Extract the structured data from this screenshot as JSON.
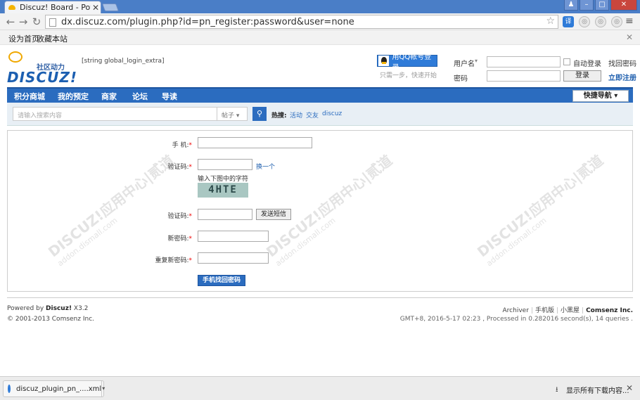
{
  "browser": {
    "tab_title": "Discuz! Board - Powered",
    "url": "dx.discuz.com/plugin.php?id=pn_register:password&user=none",
    "ext_translate": "译"
  },
  "bookmarks": [
    "设为首页",
    "收藏本站"
  ],
  "header": {
    "logo_sub": "社区动力",
    "logo_main": "DISCUZ!",
    "extra_text": "[string global_login_extra]",
    "qq_login": "用QQ帐号登录",
    "qq_hint": "只需一步，快速开始",
    "username_label": "用户名",
    "password_label": "密码",
    "auto_login": "自动登录",
    "find_password": "找回密码",
    "login_button": "登录",
    "register_link": "立即注册"
  },
  "nav": {
    "items": [
      "积分商城",
      "我的预定",
      "商家",
      "论坛",
      "导读"
    ],
    "quick_nav": "快捷导航 ▾"
  },
  "search": {
    "placeholder": "请输入搜索内容",
    "type": "帖子 ▾",
    "hot_label": "热搜:",
    "hot_items": [
      "活动",
      "交友",
      "discuz"
    ]
  },
  "form": {
    "phone_label": "手  机:",
    "captcha_label": "验证码:",
    "refresh": "换一个",
    "captcha_hint": "输入下图中的字符",
    "captcha_text": "4HTE",
    "sms_label": "验证码:",
    "sms_button": "发送短信",
    "new_pw_label": "新密码:",
    "repeat_pw_label": "重复新密码:",
    "submit": "手机找回密码"
  },
  "watermark": {
    "main": "DISCUZ!应用中心|贰道",
    "sub": "addon.dismall.com"
  },
  "footer": {
    "powered_prefix": "Powered by",
    "powered_brand": "Discuz!",
    "version": "X3.2",
    "copyright": "© 2001-2013 Comsenz Inc.",
    "links": [
      "Archiver",
      "手机版",
      "小黑屋"
    ],
    "company": "Comsenz Inc.",
    "stats": "GMT+8, 2016-5-17 02:23 , Processed in 0.282016 second(s), 14 queries ."
  },
  "download": {
    "file": "discuz_plugin_pn_....xml",
    "show_all": "显示所有下载内容..."
  }
}
